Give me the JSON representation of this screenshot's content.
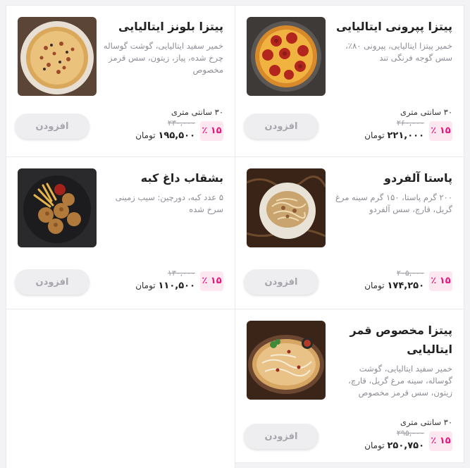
{
  "currency": "تومان",
  "add_label": "افزودن",
  "items": [
    {
      "title": "پیتزا پپرونی ایتالیایی",
      "desc": "خمیر پیتزا ایتالیایی، پپرونی ۸۰٪، سس گوجه فرنگی تند",
      "size": "۳۰ سانتی متری",
      "discount": "۱۵ ٪",
      "old_price": "۲۶۰,۰۰۰",
      "new_price": "۲۲۱,۰۰۰"
    },
    {
      "title": "پیتزا بلونز ایتالیایی",
      "desc": "خمیر سفید ایتالیایی، گوشت گوساله چرخ شده، پیاز، زیتون، سس قرمز مخصوص",
      "size": "۳۰ سانتی متری",
      "discount": "۱۵ ٪",
      "old_price": "۲۳۰,۰۰۰",
      "new_price": "۱۹۵,۵۰۰"
    },
    {
      "title": "پاستا آلفردو",
      "desc": "۲۰۰ گرم پاستا، ۱۵۰ گرم سینه مرغ گریل، قارچ، سس آلفردو",
      "discount": "۱۵ ٪",
      "old_price": "۲۰۵,۰۰۰",
      "new_price": "۱۷۴,۲۵۰"
    },
    {
      "title": "بشقاب داغ کبه",
      "desc": "۵ عدد کبه، دورچین: سیب زمینی سرخ شده",
      "discount": "۱۵ ٪",
      "old_price": "۱۳۰,۰۰۰",
      "new_price": "۱۱۰,۵۰۰"
    },
    {
      "title": "پیتزا مخصوص قمر ایتالیایی",
      "desc": "خمیر سفید ایتالیایی، گوشت گوساله، سینه مرغ گریل، قارچ، زیتون، سس قرمز مخصوص",
      "size": "۳۰ سانتی متری",
      "discount": "۱۵ ٪",
      "old_price": "۲۹۵,۰۰۰",
      "new_price": "۲۵۰,۷۵۰"
    }
  ]
}
